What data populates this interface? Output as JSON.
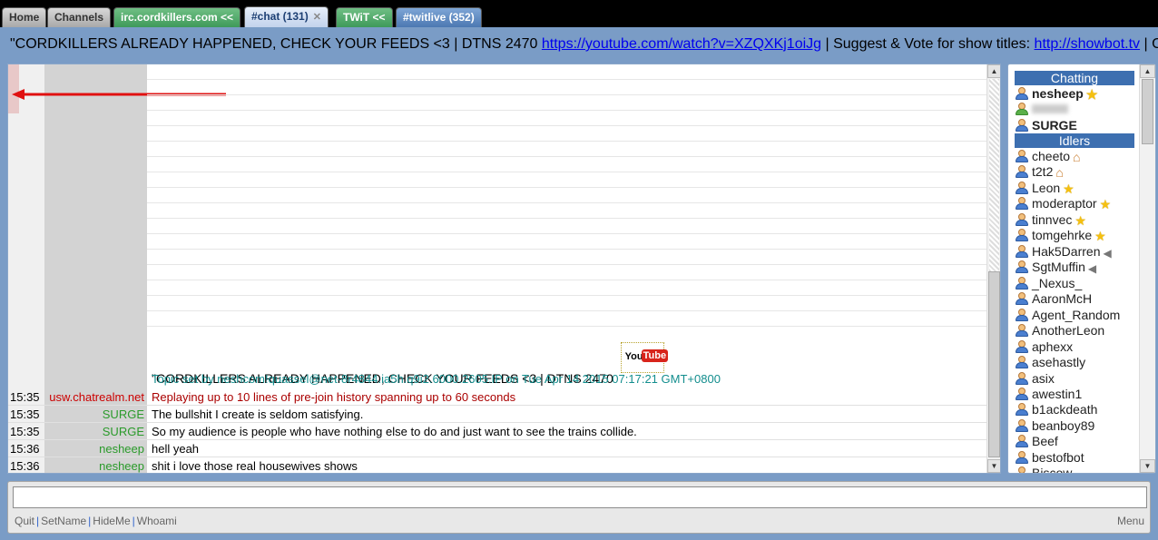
{
  "tabs": [
    {
      "label": "Home"
    },
    {
      "label": "Channels"
    },
    {
      "label": "irc.cordkillers.com <<"
    },
    {
      "label": "#chat (131)"
    },
    {
      "label": "TWiT <<"
    },
    {
      "label": "#twitlive (352)"
    }
  ],
  "topic": {
    "text_start": "\"CORDKILLERS ALREADY HAPPENED, CHECK YOUR FEEDS <3 | DTNS 2470 ",
    "link1": "https://youtube.com/watch?v=XZQXKj1oiJg",
    "text_mid": " | Suggest & Vote for show titles: ",
    "link2": "http://showbot.tv",
    "text_end": " | Caler"
  },
  "chat": {
    "topic_line": "\"CORDKILLERS ALREADY HAPPENED, CHECK YOUR FEEDS <3 | DTNS 2470",
    "youtube_you": "You",
    "youtube_tube": "Tube",
    "topic_set_line": "Topic set by neshcom!quassel@net-8r4844.ia5h.q9i2.6000.2605.IP on Tue Apr 14 2015 07:17:21 GMT+0800",
    "messages": [
      {
        "time": "15:35",
        "nick": "usw.chatrealm.net",
        "text": "Replaying up to 10 lines of pre-join history spanning up to 60 seconds"
      },
      {
        "time": "15:35",
        "nick": "SURGE",
        "text": "The bullshit I create is seldom satisfying."
      },
      {
        "time": "15:35",
        "nick": "SURGE",
        "text": "So my audience is people who have nothing else to do and just want to see the trains collide."
      },
      {
        "time": "15:36",
        "nick": "nesheep",
        "text": "hell yeah"
      },
      {
        "time": "15:36",
        "nick": "nesheep",
        "text": "shit i love those real housewives shows"
      }
    ]
  },
  "nicklist": {
    "chatting_header": "Chatting",
    "idlers_header": "Idlers",
    "chatting": [
      "nesheep",
      "SURGE"
    ],
    "idlers": [
      "cheeto",
      "t2t2",
      "Leon",
      "moderaptor",
      "tinnvec",
      "tomgehrke",
      "Hak5Darren",
      "SgtMuffin",
      "_Nexus_",
      "AaronMcH",
      "Agent_Random",
      "AnotherLeon",
      "aphexx",
      "asehastly",
      "asix",
      "awestin1",
      "b1ackdeath",
      "beanboy89",
      "Beef",
      "bestofbot",
      "Biscow"
    ]
  },
  "input": {
    "value": ""
  },
  "bottom_links": [
    "Quit",
    "SetName",
    "HideMe",
    "Whoami"
  ],
  "menu_label": "Menu",
  "colors": {
    "accent": "#3d6fb0",
    "background": "#7a9cc6",
    "server_text": "#a00",
    "nick_green": "#2a9a2a"
  }
}
